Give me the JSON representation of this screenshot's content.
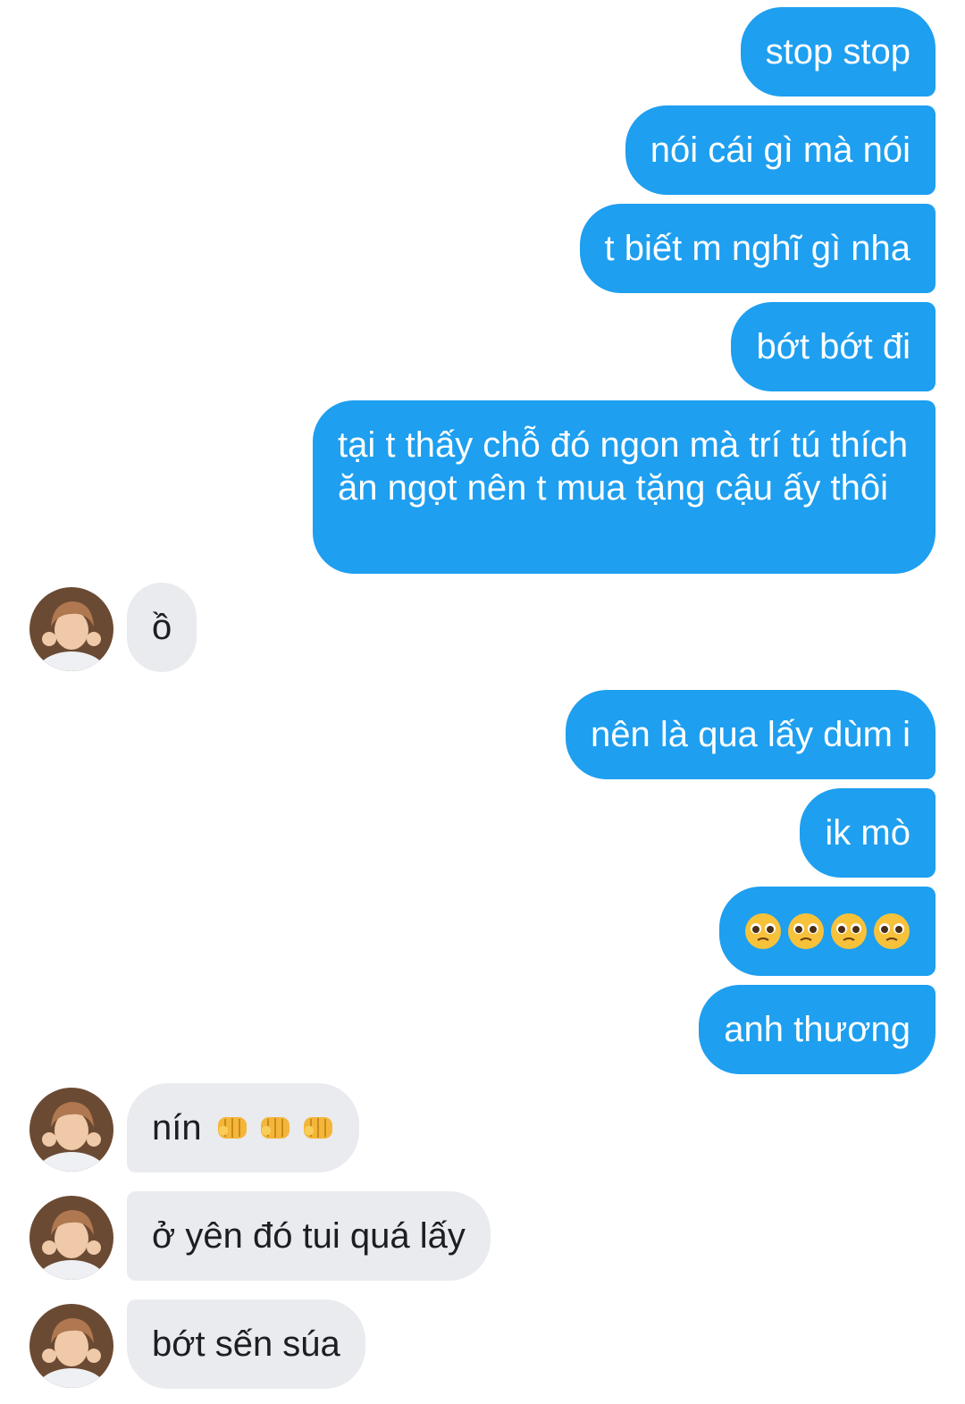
{
  "messages": [
    {
      "id": "m1",
      "side": "out",
      "text": "stop stop"
    },
    {
      "id": "m2",
      "side": "out",
      "text": "nói cái gì mà nói"
    },
    {
      "id": "m3",
      "side": "out",
      "text": "t biết m nghĩ gì nha"
    },
    {
      "id": "m4",
      "side": "out",
      "text": "bớt bớt đi"
    },
    {
      "id": "m5",
      "side": "out",
      "text": "tại t thấy chỗ đó ngon mà trí tú thích ăn ngọt nên t mua tặng cậu ấy thôi"
    },
    {
      "id": "m6",
      "side": "in",
      "text": "ồ"
    },
    {
      "id": "m7",
      "side": "out",
      "text": "nên là qua lấy dùm i"
    },
    {
      "id": "m8",
      "side": "out",
      "text": "ik mò"
    },
    {
      "id": "m9",
      "side": "out",
      "emoji": "pleading-face",
      "count": 4
    },
    {
      "id": "m10",
      "side": "out",
      "text": "anh thương"
    },
    {
      "id": "m11",
      "side": "in",
      "text": "nín",
      "emoji": "oncoming-fist",
      "count": 3
    },
    {
      "id": "m12",
      "side": "in",
      "text": "ở yên đó tui quá lấy"
    },
    {
      "id": "m13",
      "side": "in",
      "text": "bớt sến súa"
    }
  ],
  "colors": {
    "outgoing_bubble": "#1e9ff0",
    "incoming_bubble": "#e9ebee",
    "outgoing_text": "#ffffff",
    "incoming_text": "#1b1e22"
  }
}
